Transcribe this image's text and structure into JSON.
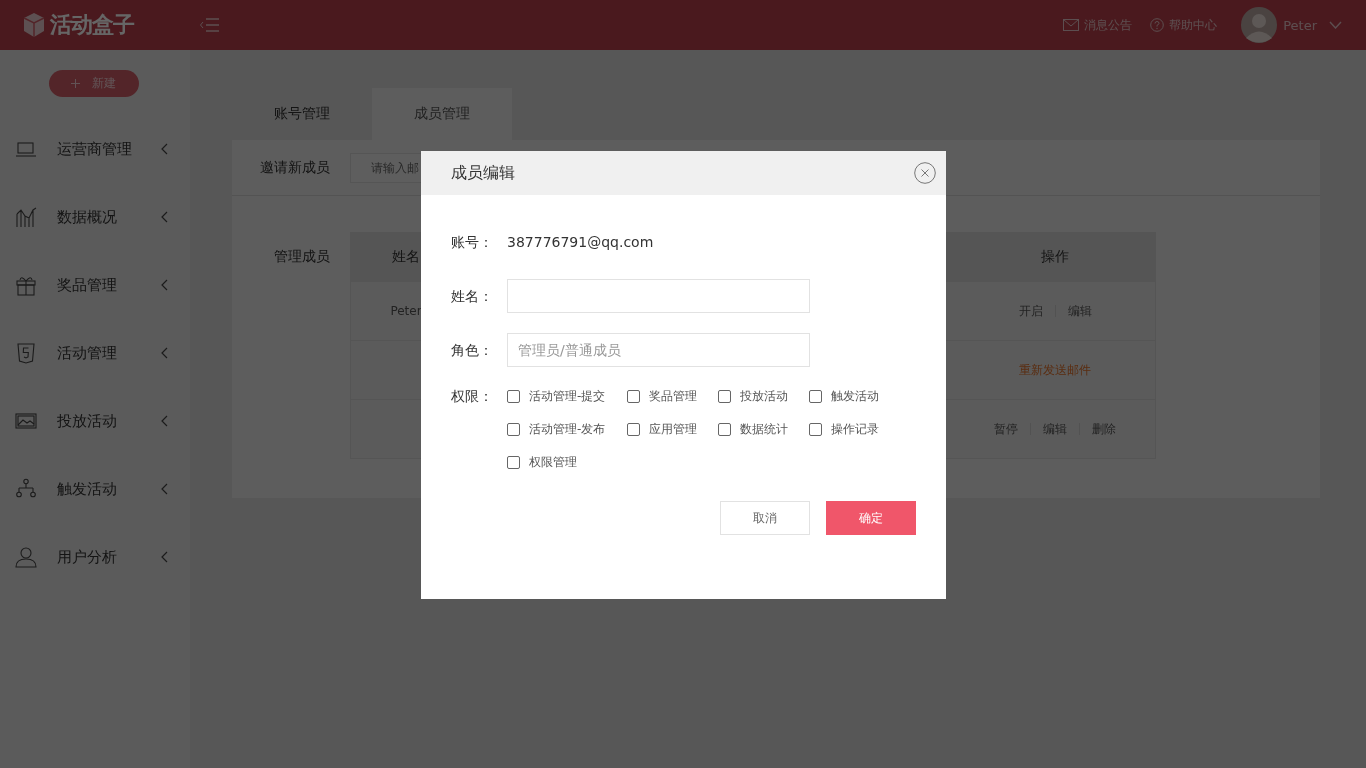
{
  "header": {
    "logo": "活动盒子",
    "links": [
      {
        "label": "消息公告",
        "kind": "mail"
      },
      {
        "label": "帮助中心",
        "kind": "help"
      }
    ],
    "user": "Peter"
  },
  "sidebar": {
    "new_button": "新建",
    "items": [
      {
        "label": "运营商管理",
        "kind": "laptop"
      },
      {
        "label": "数据概况",
        "kind": "chart"
      },
      {
        "label": "奖品管理",
        "kind": "gift"
      },
      {
        "label": "活动管理",
        "kind": "html5"
      },
      {
        "label": "投放活动",
        "kind": "image"
      },
      {
        "label": "触发活动",
        "kind": "tree"
      },
      {
        "label": "用户分析",
        "kind": "user"
      }
    ]
  },
  "tabs": [
    {
      "label": "账号管理",
      "selected": false
    },
    {
      "label": "成员管理",
      "selected": true
    }
  ],
  "invite": {
    "label": "邀请新成员",
    "placeholder": "请输入邮"
  },
  "members": {
    "label": "管理成员",
    "columns": [
      "姓名",
      "操作"
    ],
    "rows": [
      {
        "name": "Peter",
        "actions": [
          {
            "label": "开启",
            "kind": "normal"
          },
          {
            "label": "编辑",
            "kind": "normal"
          }
        ]
      },
      {
        "actions": [
          {
            "label": "重新发送邮件",
            "kind": "warning"
          }
        ]
      },
      {
        "actions": [
          {
            "label": "暂停",
            "kind": "normal"
          },
          {
            "label": "编辑",
            "kind": "normal"
          },
          {
            "label": "删除",
            "kind": "normal"
          }
        ]
      }
    ]
  },
  "dialog": {
    "title": "成员编辑",
    "account_label": "账号：",
    "account": "387776791@qq.com",
    "name_label": "姓名：",
    "role_label": "角色：",
    "role_placeholder": "管理员/普通成员",
    "permissions_label": "权限：",
    "permissions": [
      {
        "label": "活动管理-提交",
        "checked": false
      },
      {
        "label": "奖品管理",
        "checked": false
      },
      {
        "label": "投放活动",
        "checked": false
      },
      {
        "label": "触发活动",
        "checked": false
      },
      {
        "label": "活动管理-发布",
        "checked": false
      },
      {
        "label": "应用管理",
        "checked": false
      },
      {
        "label": "数据统计",
        "checked": false
      },
      {
        "label": "操作记录",
        "checked": false
      },
      {
        "label": "权限管理",
        "checked": false
      }
    ],
    "cancel": "取消",
    "confirm": "确定"
  }
}
